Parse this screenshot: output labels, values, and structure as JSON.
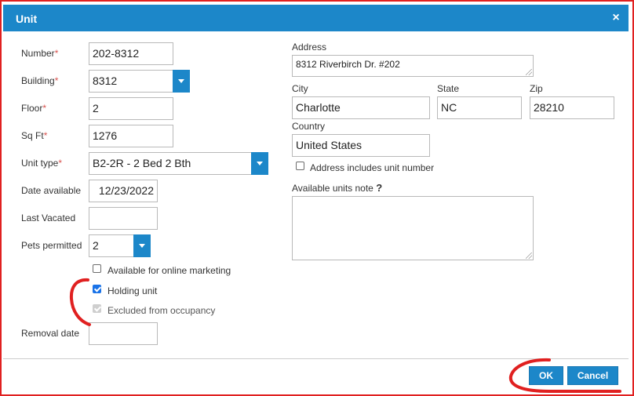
{
  "dialog": {
    "title": "Unit",
    "close_glyph": "×"
  },
  "fields": {
    "number": {
      "label": "Number",
      "required_mark": "*",
      "value": "202-8312"
    },
    "building": {
      "label": "Building",
      "required_mark": "*",
      "value": "8312"
    },
    "floor": {
      "label": "Floor",
      "required_mark": "*",
      "value": "2"
    },
    "sqft": {
      "label": "Sq Ft",
      "required_mark": "*",
      "value": "1276"
    },
    "unit_type": {
      "label": "Unit type",
      "required_mark": "*",
      "value": "B2-2R - 2 Bed 2 Bth"
    },
    "date_available": {
      "label": "Date available",
      "value": "12/23/2022"
    },
    "last_vacated": {
      "label": "Last Vacated",
      "value": ""
    },
    "pets_permitted": {
      "label": "Pets permitted",
      "value": "2"
    },
    "removal_date": {
      "label": "Removal date",
      "value": ""
    },
    "address": {
      "label": "Address",
      "value": "8312 Riverbirch Dr. #202"
    },
    "city": {
      "label": "City",
      "value": "Charlotte"
    },
    "state": {
      "label": "State",
      "value": "NC"
    },
    "zip": {
      "label": "Zip",
      "value": "28210"
    },
    "country": {
      "label": "Country",
      "value": "United States"
    },
    "available_units_note": {
      "label": "Available units note",
      "help": "?",
      "value": ""
    }
  },
  "checkboxes": {
    "online_marketing": {
      "label": "Available for online marketing",
      "checked": false
    },
    "holding_unit": {
      "label": "Holding unit",
      "checked": true
    },
    "excluded_occupancy": {
      "label": "Excluded from occupancy",
      "checked": true,
      "disabled": true
    },
    "address_includes_unit": {
      "label": "Address includes unit number",
      "checked": false
    }
  },
  "buttons": {
    "ok": "OK",
    "cancel": "Cancel"
  },
  "colors": {
    "accent": "#1c87c9",
    "annotation": "#e02020",
    "required": "#d9534f"
  }
}
